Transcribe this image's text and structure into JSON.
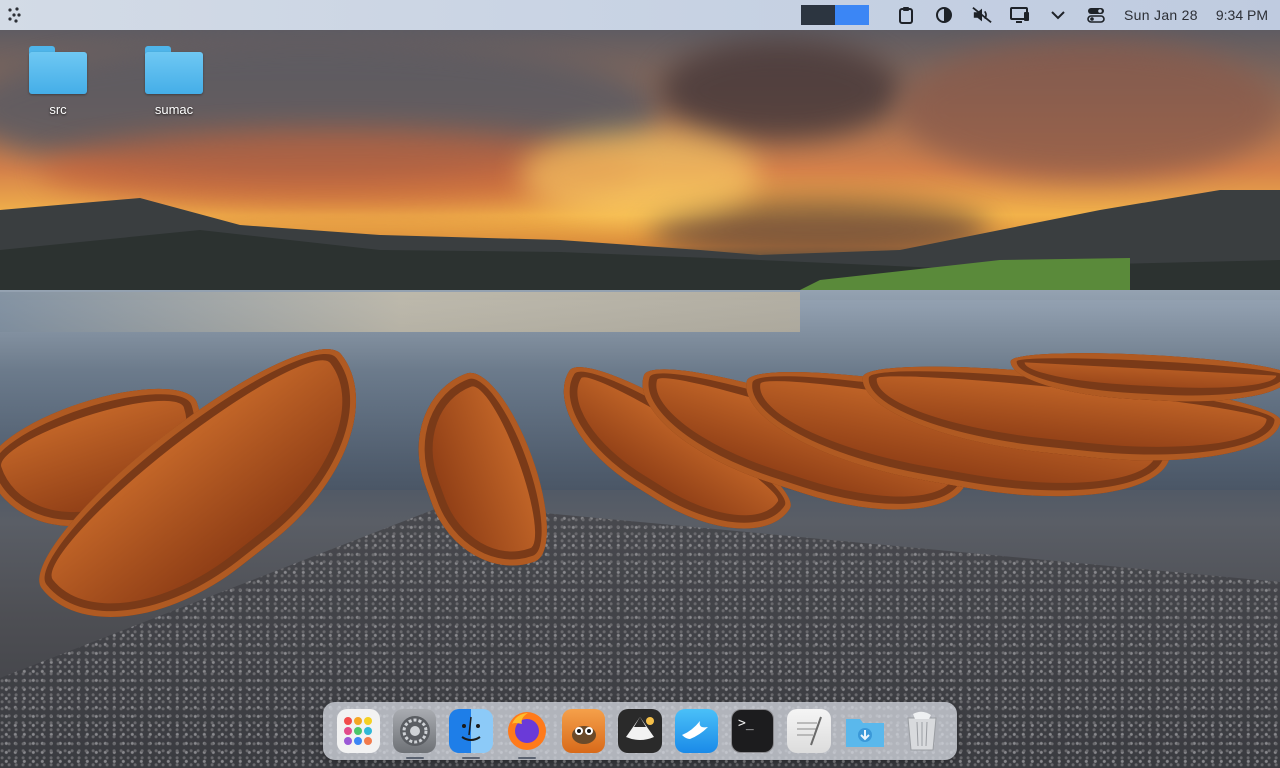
{
  "topbar": {
    "launcher_icon": "launcher-dots-icon",
    "workspaces": [
      "workspace-1",
      "workspace-2"
    ],
    "tray": [
      {
        "name": "clipboard-icon"
      },
      {
        "name": "night-mode-icon"
      },
      {
        "name": "volume-muted-icon"
      },
      {
        "name": "display-icon"
      },
      {
        "name": "chevron-down-icon"
      },
      {
        "name": "control-toggle-icon"
      }
    ],
    "date": "Sun  Jan 28",
    "time": "9:34 PM"
  },
  "desktop_icons": [
    {
      "label": "src",
      "icon": "folder-icon"
    },
    {
      "label": "sumac",
      "icon": "folder-icon"
    }
  ],
  "dock": {
    "items": [
      {
        "name": "launchpad-icon",
        "color": "#f2f2f2"
      },
      {
        "name": "system-settings-icon",
        "color": "#8a8d92"
      },
      {
        "name": "finder-icon",
        "color": "#2f8ff0"
      },
      {
        "name": "firefox-icon",
        "color": "#ff7a1a"
      },
      {
        "name": "gimp-icon",
        "color": "#f08a2a"
      },
      {
        "name": "inkscape-icon",
        "color": "#2a2a2a"
      },
      {
        "name": "xcode-bird-icon",
        "color": "#2aa6f5"
      },
      {
        "name": "terminal-icon",
        "color": "#1c1c1e"
      },
      {
        "name": "text-editor-icon",
        "color": "#eaeaea"
      },
      {
        "name": "downloads-folder-icon",
        "color": "#5ab8ec"
      },
      {
        "name": "trash-icon",
        "color": "#d8dadd"
      }
    ],
    "terminal_prompt": ">_",
    "colors": {
      "accent": "#3b86f5"
    }
  }
}
